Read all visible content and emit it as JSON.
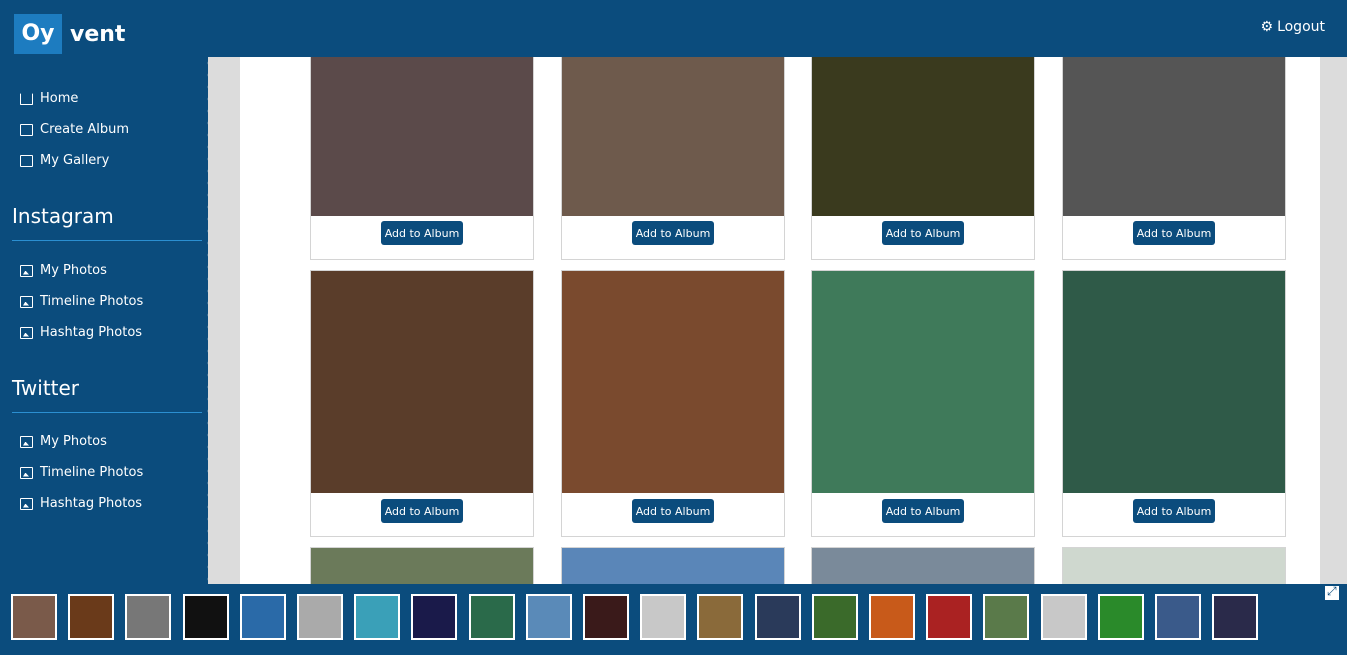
{
  "app": {
    "logo_box": "Oy",
    "logo_rest": "vent",
    "logout_label": "Logout"
  },
  "sidebar": {
    "top_items": [
      {
        "label": "Home",
        "icon": "home-icon"
      },
      {
        "label": "Create Album",
        "icon": "create-album-icon"
      },
      {
        "label": "My Gallery",
        "icon": "folder-icon"
      }
    ],
    "sections": [
      {
        "title": "Instagram",
        "items": [
          {
            "label": "My Photos"
          },
          {
            "label": "Timeline Photos"
          },
          {
            "label": "Hashtag Photos"
          }
        ]
      },
      {
        "title": "Twitter",
        "items": [
          {
            "label": "My Photos"
          },
          {
            "label": "Timeline Photos"
          },
          {
            "label": "Hashtag Photos"
          }
        ]
      }
    ]
  },
  "gallery": {
    "button_label": "Add to Album",
    "cards": [
      {
        "color": "#5b4a4a"
      },
      {
        "color": "#6e5a4c"
      },
      {
        "color": "#3a3a1e"
      },
      {
        "color": "#555555"
      },
      {
        "color": "#5a3d2a"
      },
      {
        "color": "#7a4a2e"
      },
      {
        "color": "#3f7a5a"
      },
      {
        "color": "#2f5a48"
      },
      {
        "color": "#6b7a5a"
      },
      {
        "color": "#5a86b8"
      },
      {
        "color": "#7a8a9a"
      },
      {
        "color": "#cfd8cf"
      }
    ]
  },
  "thumbnails": [
    "#7a5a4a",
    "#6a3a1a",
    "#777777",
    "#111111",
    "#2a6aa8",
    "#aaaaaa",
    "#3aa0b8",
    "#1a1a4a",
    "#2a6a4a",
    "#5a8ab8",
    "#3a1a1a",
    "#c8c8c8",
    "#8a6a3a",
    "#2a3a5a",
    "#3a6a2a",
    "#c85a1a",
    "#aa2222",
    "#5a7a4a",
    "#c8c8c8",
    "#2a8a2a",
    "#3a5a8a",
    "#2a2a4a"
  ]
}
